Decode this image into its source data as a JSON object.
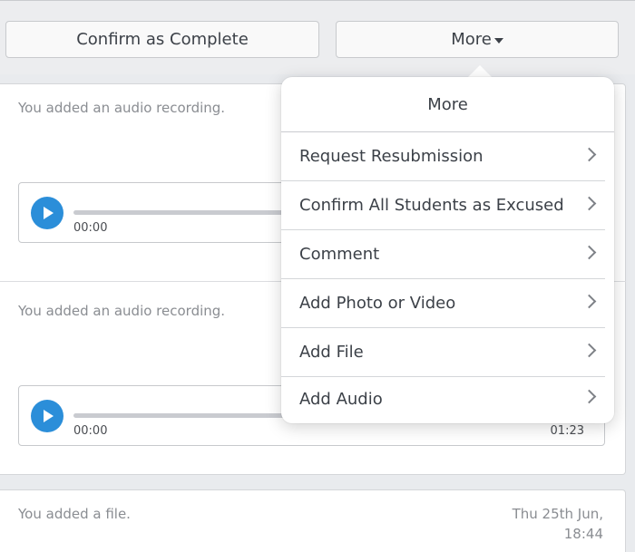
{
  "toolbar": {
    "confirm_label": "Confirm as Complete",
    "more_label": "More"
  },
  "entries": [
    {
      "text": "You added an audio recording.",
      "player": {
        "current": "00:00",
        "duration": ""
      }
    },
    {
      "text": "You added an audio recording.",
      "player": {
        "current": "00:00",
        "duration": "01:23"
      }
    }
  ],
  "file_entry": {
    "text": "You added a file.",
    "date": "Thu 25th Jun,",
    "time": "18:44"
  },
  "popover": {
    "title": "More",
    "items": [
      {
        "label": "Request Resubmission"
      },
      {
        "label": "Confirm All Students as Excused"
      },
      {
        "label": "Comment"
      },
      {
        "label": "Add Photo or Video"
      },
      {
        "label": "Add File"
      },
      {
        "label": "Add Audio"
      }
    ]
  },
  "colors": {
    "accent": "#2b8ed9",
    "background": "#e9ebee"
  }
}
